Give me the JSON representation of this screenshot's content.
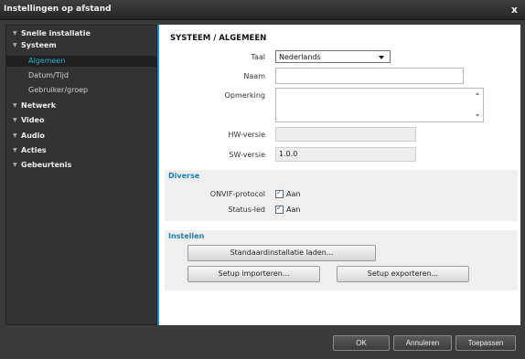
{
  "window": {
    "title": "Instellingen op afstand",
    "close_glyph": "x"
  },
  "sidebar": {
    "items": [
      {
        "label": "Snelle installatie",
        "expanded": false
      },
      {
        "label": "Systeem",
        "expanded": true,
        "children": [
          {
            "label": "Algemeen",
            "active": true
          },
          {
            "label": "Datum/Tijd",
            "active": false
          },
          {
            "label": "Gebruiker/groep",
            "active": false
          }
        ]
      },
      {
        "label": "Netwerk",
        "expanded": false
      },
      {
        "label": "Video",
        "expanded": false
      },
      {
        "label": "Audio",
        "expanded": false
      },
      {
        "label": "Acties",
        "expanded": false
      },
      {
        "label": "Gebeurtenis",
        "expanded": false
      }
    ],
    "arrow_glyph": "▼"
  },
  "main": {
    "section_title": "SYSTEEM / ALGEMEEN",
    "fields": {
      "taal": {
        "label": "Taal",
        "value": "Nederlands"
      },
      "naam": {
        "label": "Naam",
        "value": ""
      },
      "opmerking": {
        "label": "Opmerking",
        "value": ""
      },
      "hw_versie": {
        "label": "HW-versie",
        "value": ""
      },
      "sw_versie": {
        "label": "SW-versie",
        "value": "1.0.0"
      }
    },
    "diverse": {
      "title": "Diverse",
      "onvif": {
        "label": "ONVIF-protocol",
        "checkbox_label": "Aan",
        "checked": true
      },
      "status_led": {
        "label": "Status-led",
        "checkbox_label": "Aan",
        "checked": true
      }
    },
    "instellen": {
      "title": "Instellen",
      "load_default": "Standaardinstallatie laden...",
      "import": "Setup importeren...",
      "export": "Setup exporteren..."
    }
  },
  "footer": {
    "ok": "OK",
    "cancel": "Annuleren",
    "apply": "Toepassen"
  },
  "colors": {
    "accent": "#1a8ed0",
    "active_nav": "#1fb0d8",
    "group_title": "#1e7fb8"
  },
  "check_glyph": "✓"
}
